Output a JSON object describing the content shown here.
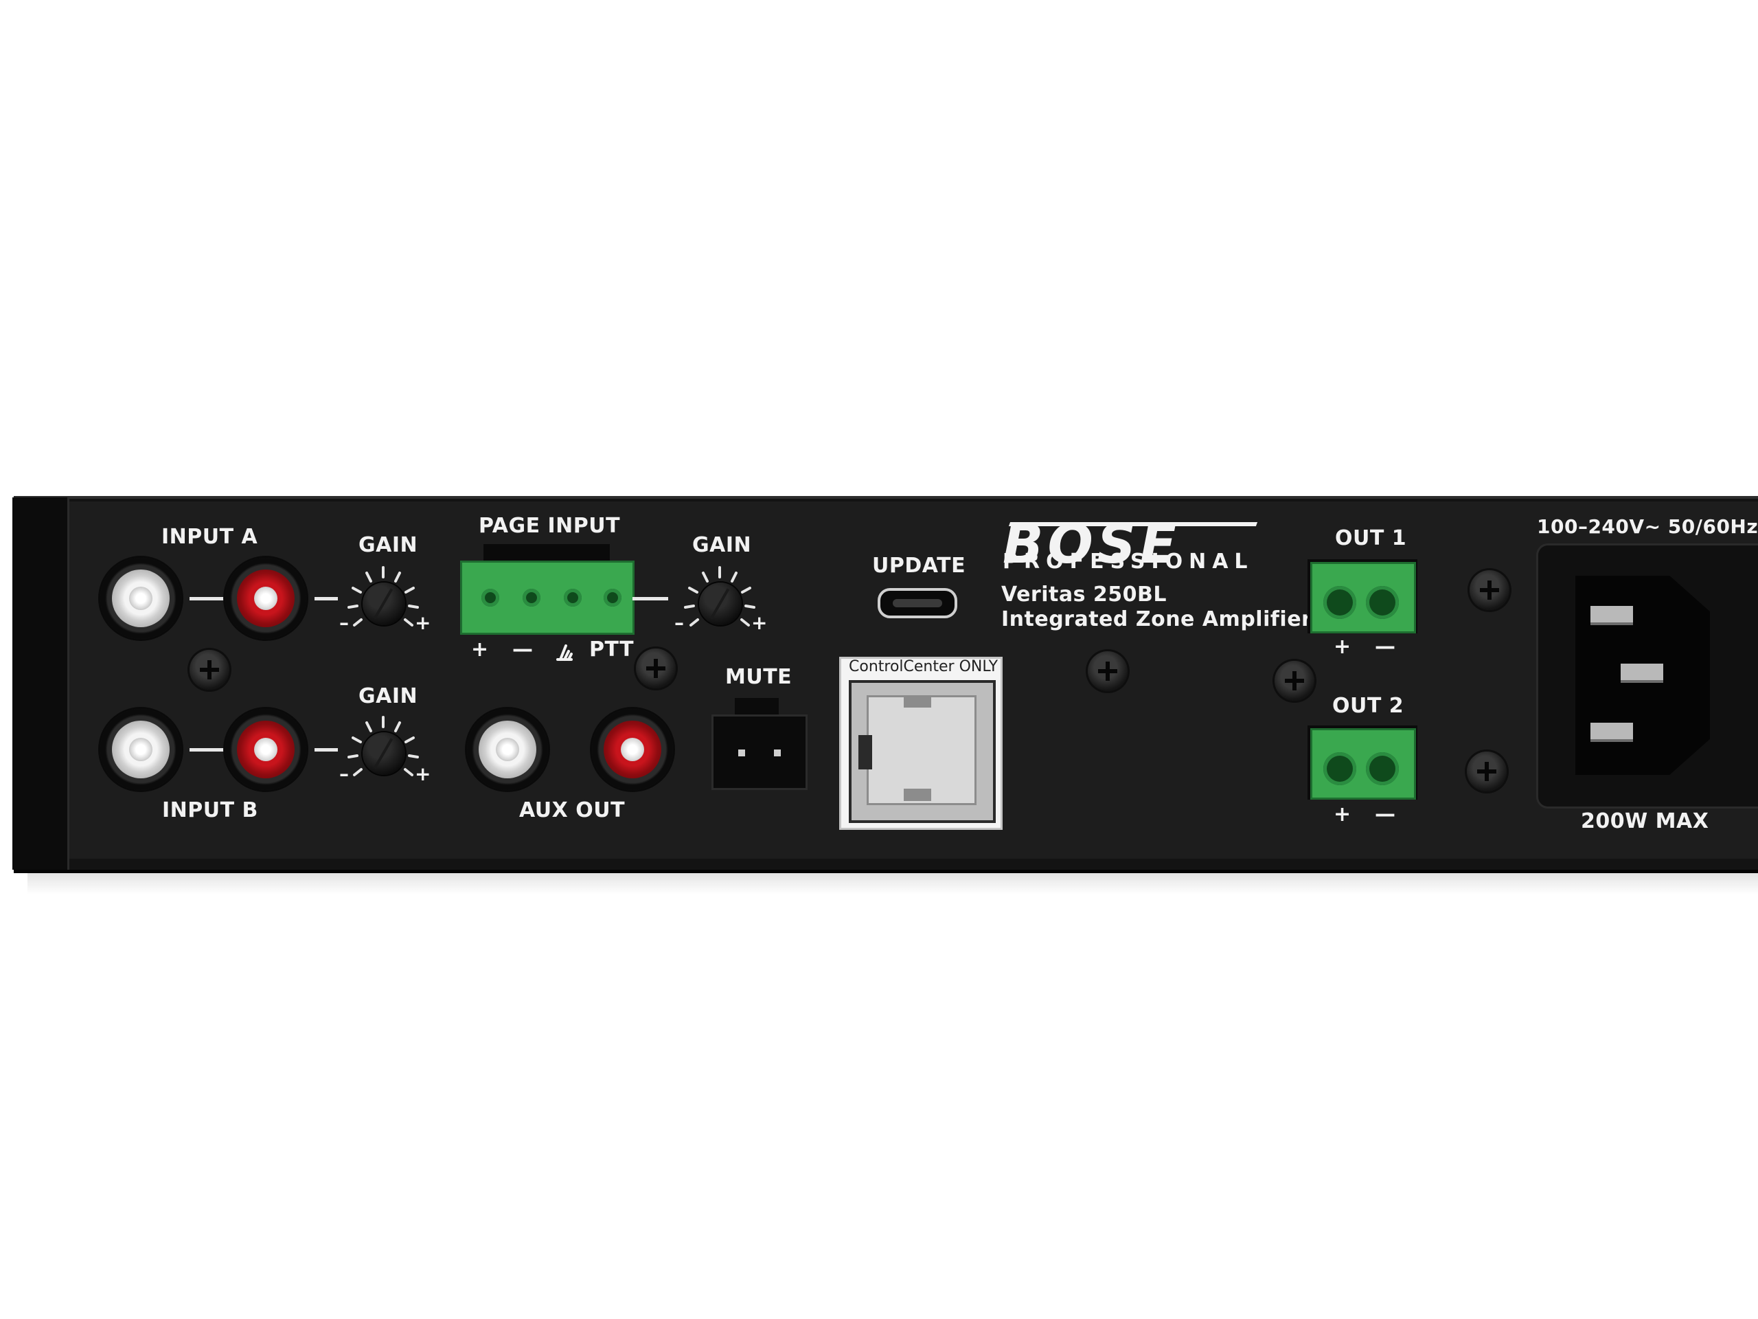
{
  "brand": {
    "logo": "BOSE",
    "sub": "PROFESSIONAL"
  },
  "model": {
    "line1": "Veritas 250BL",
    "line2": "Integrated Zone Amplifier"
  },
  "labels": {
    "input_a": "INPUT A",
    "input_b": "INPUT B",
    "gain": "GAIN",
    "page_input": "PAGE INPUT",
    "plus": "+",
    "minus": "—",
    "ptt": "PTT",
    "aux_out": "AUX OUT",
    "mute": "MUTE",
    "update": "UPDATE",
    "control_center": "ControlCenter ONLY",
    "out1": "OUT 1",
    "out2": "OUT 2",
    "power_rating": "100–240V~ 50/60Hz",
    "max_power": "200W MAX",
    "knob_minus": "–",
    "knob_plus": "+"
  },
  "colors": {
    "chassis": "#1d1d1d",
    "terminal_green": "#3aa84f",
    "rca_red": "#c8141c",
    "rca_white": "#f4f4f4"
  }
}
